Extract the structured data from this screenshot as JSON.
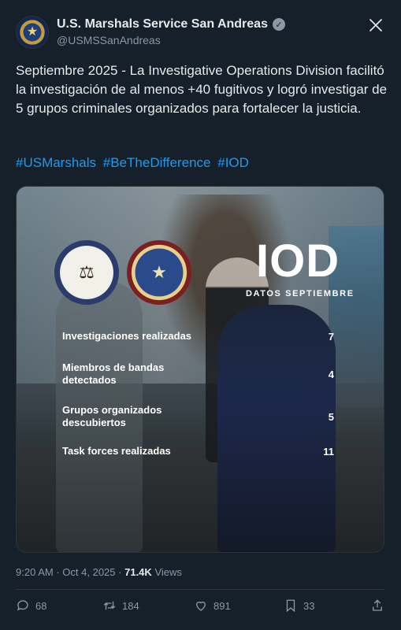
{
  "account": {
    "display_name": "U.S. Marshals Service San Andreas",
    "handle": "@USMSSanAndreas"
  },
  "tweet": {
    "text": "Septiembre 2025 - La Investigative Operations Division facilitó la investigación de al menos +40 fugitivos y logró investigar de 5 grupos criminales organizados para fortalecer la justicia.",
    "hashtags": [
      "#USMarshals",
      "#BeTheDifference",
      "#IOD"
    ]
  },
  "image": {
    "title": "IOD",
    "subtitle": "DATOS SEPTIEMBRE",
    "stats": [
      {
        "label": "Investigaciones realizadas",
        "value": "7"
      },
      {
        "label": "Miembros de bandas detectados",
        "value": "4"
      },
      {
        "label": "Grupos organizados descubiertos",
        "value": "5"
      },
      {
        "label": "Task forces realizadas",
        "value": "11"
      }
    ]
  },
  "meta": {
    "time": "9:20 AM",
    "separator": "·",
    "date": "Oct 4, 2025",
    "views_count": "71.4K",
    "views_label": "Views"
  },
  "actions": {
    "replies": "68",
    "reposts": "184",
    "likes": "891",
    "bookmarks": "33"
  },
  "colors": {
    "background": "#15202b",
    "hashtag": "#1d9bf0",
    "secondary_text": "#8b98a5"
  }
}
